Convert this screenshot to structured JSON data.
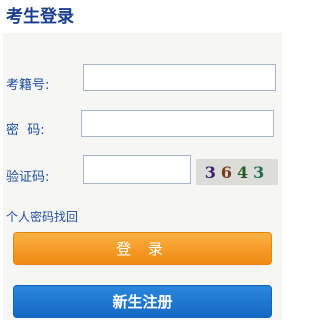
{
  "header": {
    "title": "考生登录"
  },
  "form": {
    "exam_id_label": "考籍号:",
    "password_label": "密  码:",
    "captcha_label": "验证码:",
    "exam_id_value": "",
    "password_value": "",
    "captcha_value": "",
    "captcha_digits": [
      "3",
      "6",
      "4",
      "3"
    ]
  },
  "links": {
    "recover_password": "个人密码找回"
  },
  "buttons": {
    "login": "登 录",
    "register": "新生注册"
  },
  "colors": {
    "title": "#1a3c8f",
    "label": "#1f4e9e",
    "login_button": "#f39a1e",
    "register_button": "#1a75d1"
  }
}
